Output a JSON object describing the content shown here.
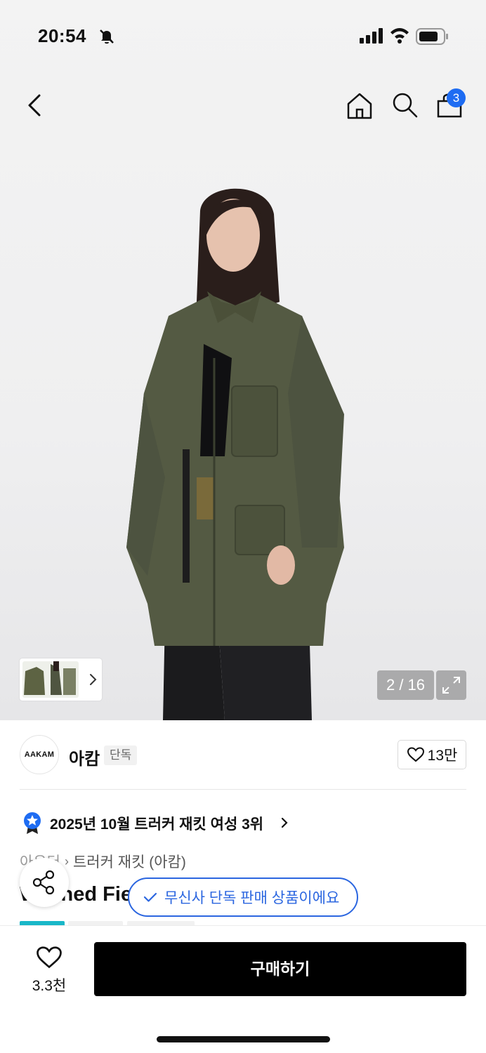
{
  "status_bar": {
    "time": "20:54"
  },
  "nav": {
    "cart_count": "3"
  },
  "gallery": {
    "counter": "2 / 16"
  },
  "brand": {
    "logo_text": "AAKAM",
    "name": "아캄",
    "tag": "단독",
    "likes": "13만"
  },
  "ranking": {
    "text": "2025년 10월 트러커 재킷 여성 3위"
  },
  "breadcrumb": {
    "level1": "아우터",
    "level2": "트러커 재킷 (아캄)"
  },
  "product": {
    "title": "Washed Field Jacket"
  },
  "exclusive": {
    "text": "무신사 단독 판매 상품이에요"
  },
  "bottom": {
    "wish_count": "3.3천",
    "buy_label": "구매하기"
  },
  "colors": {
    "accent": "#1e6cf2",
    "pill": "#2b66e0",
    "tag_teal": "#19b7c8"
  }
}
